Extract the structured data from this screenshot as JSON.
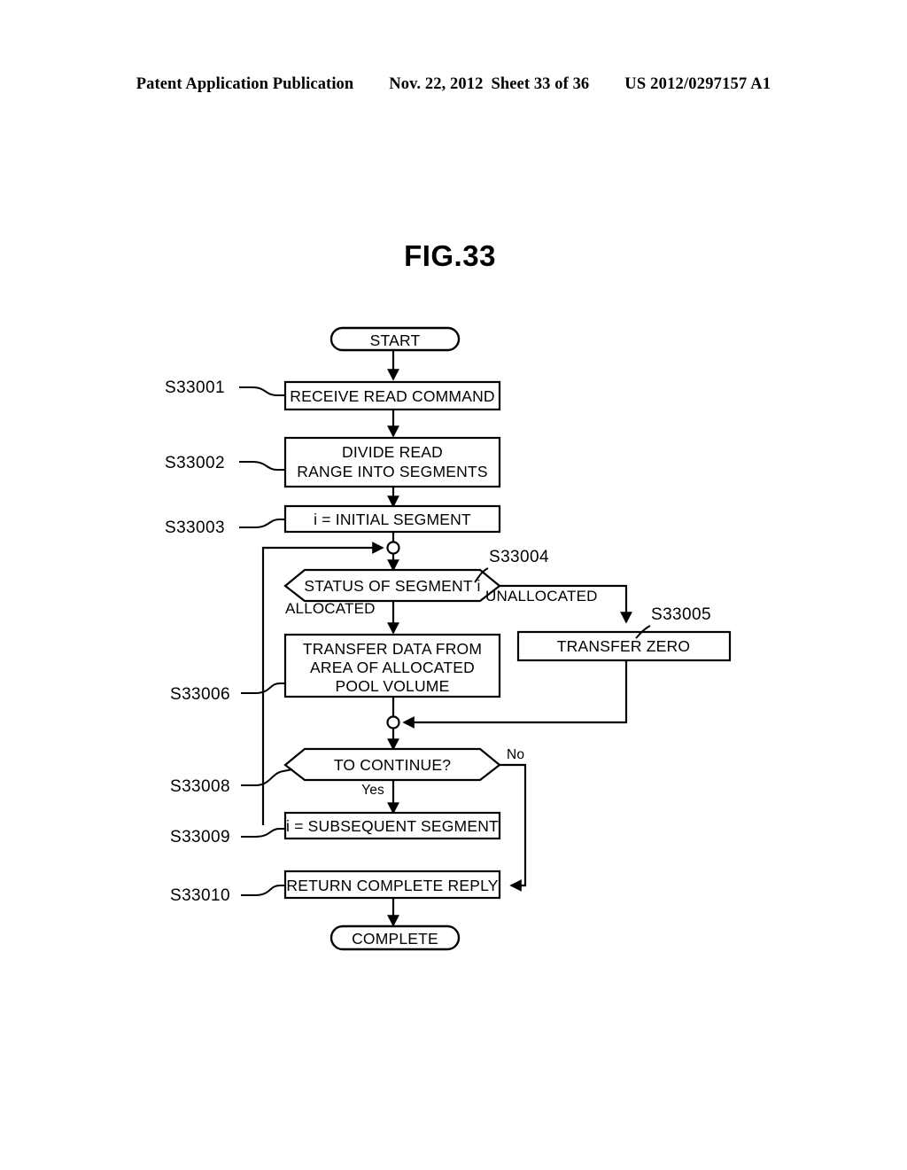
{
  "header": {
    "publication": "Patent Application Publication",
    "date": "Nov. 22, 2012",
    "sheet": "Sheet 33 of 36",
    "number": "US 2012/0297157 A1"
  },
  "figure": {
    "title": "FIG.33",
    "nodes": {
      "start": "START",
      "s33001": "RECEIVE READ COMMAND",
      "s33002_line1": "DIVIDE READ",
      "s33002_line2": "RANGE INTO SEGMENTS",
      "s33003": "i = INITIAL SEGMENT",
      "s33004": "STATUS OF SEGMENT i",
      "s33005": "TRANSFER ZERO",
      "s33006_line1": "TRANSFER DATA FROM",
      "s33006_line2": "AREA OF ALLOCATED",
      "s33006_line3": "POOL VOLUME",
      "s33008": "TO CONTINUE?",
      "s33009": "i = SUBSEQUENT SEGMENT",
      "s33010": "RETURN COMPLETE REPLY",
      "complete": "COMPLETE"
    },
    "refs": {
      "s33001": "S33001",
      "s33002": "S33002",
      "s33003": "S33003",
      "s33004": "S33004",
      "s33005": "S33005",
      "s33006": "S33006",
      "s33008": "S33008",
      "s33009": "S33009",
      "s33010": "S33010"
    },
    "edge_labels": {
      "allocated": "ALLOCATED",
      "unallocated": "UNALLOCATED",
      "yes": "Yes",
      "no": "No"
    }
  }
}
